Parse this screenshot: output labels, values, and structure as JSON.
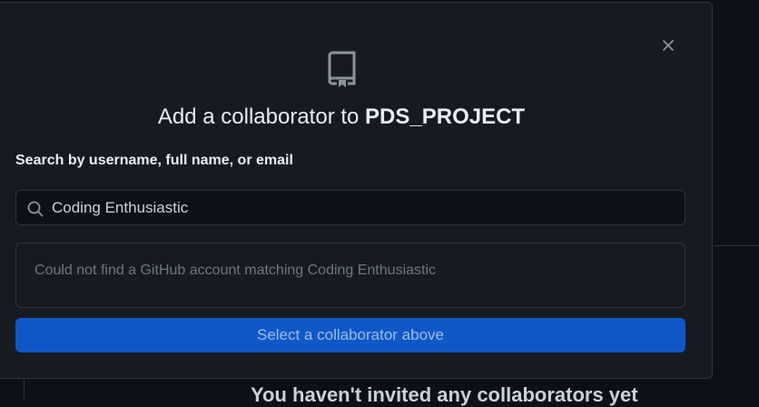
{
  "background": {
    "empty_state_text": "You haven't invited any collaborators yet"
  },
  "modal": {
    "title_prefix": "Add a collaborator to ",
    "repo_name": "PDS_PROJECT",
    "search_label": "Search by username, full name, or email",
    "search_value": "Coding Enthusiastic",
    "search_icon": "search-icon",
    "no_results_message": "Could not find a GitHub account matching Coding Enthusiastic",
    "select_button_label": "Select a collaborator above",
    "close_icon": "close-icon",
    "header_icon": "repo-icon"
  },
  "colors": {
    "background": "#0d1117",
    "modal_bg": "#161b22",
    "border": "#30363d",
    "button_bg": "#1158c7",
    "button_text_disabled": "#9fbbe4",
    "muted_text": "#6e7681",
    "primary_text": "#e6edf3"
  }
}
